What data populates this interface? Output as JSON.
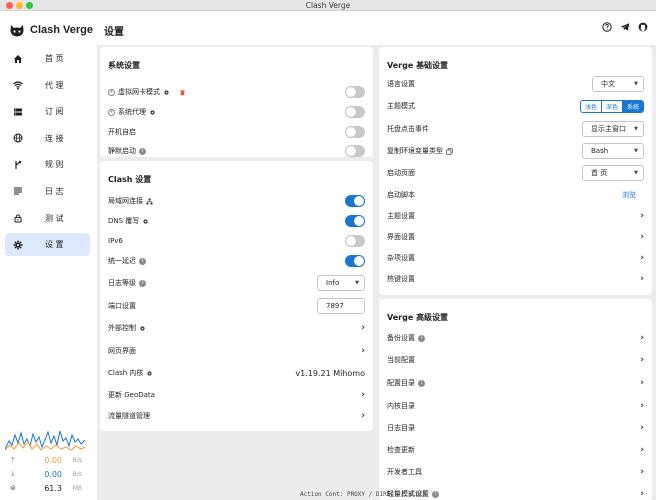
{
  "window": {
    "title": "Clash Verge"
  },
  "app": {
    "name": "Clash Verge"
  },
  "nav": [
    {
      "label": "首 页",
      "icon": "home-icon"
    },
    {
      "label": "代 理",
      "icon": "wifi-icon"
    },
    {
      "label": "订 阅",
      "icon": "storage-icon"
    },
    {
      "label": "连 接",
      "icon": "globe-icon"
    },
    {
      "label": "规 则",
      "icon": "fork-icon"
    },
    {
      "label": "日 志",
      "icon": "list-icon"
    },
    {
      "label": "测 试",
      "icon": "lock-icon"
    },
    {
      "label": "设 置",
      "icon": "gear-icon",
      "active": true
    }
  ],
  "traffic": {
    "up": {
      "value": "0.00",
      "unit": "B/s"
    },
    "down": {
      "value": "0.00",
      "unit": "B/s"
    },
    "mem": {
      "value": "61.3",
      "unit": "MB"
    }
  },
  "header": {
    "title": "设置"
  },
  "system": {
    "title": "系统设置",
    "rows": [
      {
        "label": "虚拟网卡模式"
      },
      {
        "label": "系统代理"
      },
      {
        "label": "开机自启"
      },
      {
        "label": "静默启动"
      }
    ]
  },
  "clash": {
    "title": "Clash 设置",
    "lan": "局域网连接",
    "dns": "DNS 覆写",
    "ipv6": "IPv6",
    "latency": "统一延迟",
    "loglevel": {
      "label": "日志等级",
      "value": "Info"
    },
    "port": {
      "label": "端口设置",
      "value": "7897"
    },
    "external": "外部控制",
    "webui": "网页界面",
    "core": {
      "label": "Clash 内核",
      "value": "v1.19.21 Mihomo"
    },
    "geodata": "更新 GeoData",
    "tunnels": "流量隧道管理"
  },
  "verge_basic": {
    "title": "Verge 基础设置",
    "language": {
      "label": "语言设置",
      "value": "中文"
    },
    "theme": {
      "label": "主题模式",
      "options": [
        "浅色",
        "深色",
        "系统"
      ]
    },
    "tray": {
      "label": "托盘点击事件",
      "value": "显示主窗口"
    },
    "copyenv": {
      "label": "复制环境变量类型",
      "value": "Bash"
    },
    "startpage": {
      "label": "启动页面",
      "value": "首 页"
    },
    "startscript": {
      "label": "启动脚本",
      "action": "浏览"
    },
    "themeset": "主题设置",
    "ui": "界面设置",
    "misc": "杂项设置",
    "hotkey": "热键设置"
  },
  "verge_adv": {
    "title": "Verge 高级设置",
    "backup": "备份设置",
    "currentcfg": "当前配置",
    "cfgdir": "配置目录",
    "coredir": "内核目录",
    "logdir": "日志目录",
    "update": "检查更新",
    "devtools": "开发者工具",
    "lite": "轻量模式设置"
  },
  "overlay": {
    "text": "Action Cont: PROXY / DIRECT / BLOCK"
  },
  "colors": {
    "accent": "#1976d2",
    "up": "#f39c38",
    "down": "#1976d2",
    "danger": "#e5533a"
  }
}
